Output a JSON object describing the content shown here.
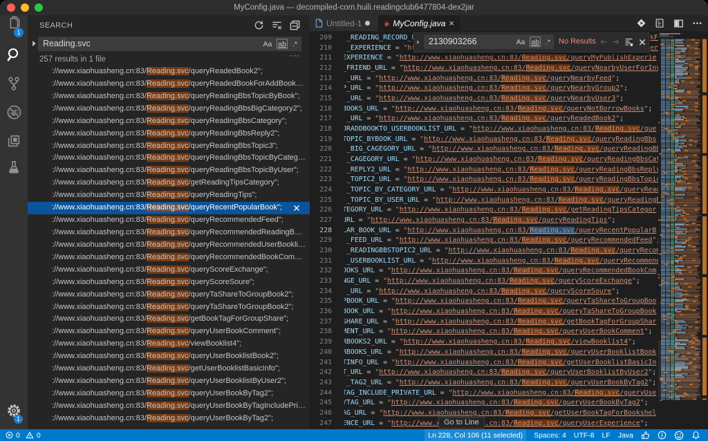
{
  "window": {
    "title": "MyConfig.java — decompiled-com.huili.readingclub6477804-dex2jar"
  },
  "colors": {
    "accent": "#007acc",
    "match_highlight": "#ea5c00",
    "selection": "#264f78",
    "list_selection": "#0a549b",
    "error_text": "#f48771"
  },
  "activity_bar": {
    "items": [
      {
        "name": "explorer",
        "badge": "1"
      },
      {
        "name": "search",
        "active": true
      },
      {
        "name": "source-control"
      },
      {
        "name": "debug-disabled"
      },
      {
        "name": "extensions"
      },
      {
        "name": "testing"
      }
    ],
    "manage_badge": "1"
  },
  "sidebar": {
    "title": "SEARCH",
    "actions": [
      "refresh",
      "clear-search-results",
      "collapse-all"
    ],
    "search_input": {
      "value": "Reading.svc",
      "options": {
        "match_case": "Aa",
        "whole_word": "ab",
        "regex": ".*"
      }
    },
    "more_label": "···",
    "results_summary": "257 results in 1 file",
    "match": "Reading.svc",
    "result_prefix": "://www.xiaohuasheng.cn:83/",
    "results": [
      {
        "suffix": "/queryReadedBook2\";"
      },
      {
        "suffix": "/queryReadedBookForAddBookT…"
      },
      {
        "suffix": "/queryReadingBbsTopicByBook\";"
      },
      {
        "suffix": "/queryReadingBbsBigCategory2\";"
      },
      {
        "suffix": "/queryReadingBbsCategory\";"
      },
      {
        "suffix": "/queryReadingBbsReply2\";"
      },
      {
        "suffix": "/queryReadingBbsTopic3\";"
      },
      {
        "suffix": "/queryReadingBbsTopicByCatego…"
      },
      {
        "suffix": "/queryReadingBbsTopicByUser\";"
      },
      {
        "suffix": "/getReadingTipsCategory\";"
      },
      {
        "suffix": "/queryReadingTips\";"
      },
      {
        "suffix": "/queryRecentPopularBook\";",
        "selected": true
      },
      {
        "suffix": "/queryRecommendedFeed\";"
      },
      {
        "suffix": "/queryRecommendedReadingBbs…"
      },
      {
        "suffix": "/queryRecommendedUserBooklis…"
      },
      {
        "suffix": "/queryRecommendedBookComm…"
      },
      {
        "suffix": "/queryScoreExchange\";"
      },
      {
        "suffix": "/queryScoreSoure\";"
      },
      {
        "suffix": "/queryTaShareToGroupBook2\";"
      },
      {
        "suffix": "/queryTaShareToGroupBook2\";"
      },
      {
        "suffix": "/getBookTagForGroupShare\";"
      },
      {
        "suffix": "/queryUserBookComment\";"
      },
      {
        "suffix": "/viewBooklist4\";"
      },
      {
        "suffix": "/queryUserBooklistBook2\";"
      },
      {
        "suffix": "/getUserBooklistBasicInfo\";"
      },
      {
        "suffix": "/queryUserBooklistByUser2\";"
      },
      {
        "suffix": "/queryUserBookByTag2\";"
      },
      {
        "suffix": "/queryUserBookByTagIncludePriv…"
      },
      {
        "suffix": "/queryUserBookByTag2\";"
      }
    ]
  },
  "editor": {
    "tabs": [
      {
        "label": "Untitled-1",
        "icon": "file",
        "modified": true
      },
      {
        "label": "MyConfig.java",
        "icon": "java",
        "active": true,
        "close": "×"
      }
    ],
    "find": {
      "value": "2130903266",
      "status": "No Results",
      "options": {
        "match_case": "Aa",
        "whole_word": "ab",
        "regex": ".*"
      }
    },
    "url_base": "http://www.xiaohuasheng.cn:83/",
    "match": "Reading.svc",
    "tooltip": "Go to Line",
    "lines": [
      {
        "n": 209,
        "id": "_READING_RECORD_U",
        "covered": true,
        "tail": "kF"
      },
      {
        "n": 210,
        "id": "_EXPERIENCE",
        "pre": "\"ht",
        "covered": true,
        "tail": "er"
      },
      {
        "n": 211,
        "cut": "E",
        "id": "XPERIENCE",
        "path": "queryMyPublishExperie"
      },
      {
        "n": 212,
        "cut": "_",
        "id": "FRIEND_URL",
        "path": "queryNearbyUserForInv"
      },
      {
        "n": 213,
        "id": "_URL",
        "path": "queryNearbyFeed",
        "end": true
      },
      {
        "n": 214,
        "cut": "P",
        "id": "_URL",
        "path": "queryNearbyGroup2",
        "end": true
      },
      {
        "n": 215,
        "id": "_URL",
        "path": "queryNearbyUser3",
        "end": true
      },
      {
        "n": 216,
        "cut": "B",
        "id": "OOKS_URL",
        "path": "queryNotBorrowBooks",
        "end": true
      },
      {
        "n": 217,
        "id": "_URL",
        "path": "queryReadedBook2",
        "end": true
      },
      {
        "n": 218,
        "cut": "O",
        "id": "RADDBOOKTO_USERBOOKLIST_URL",
        "path": "que"
      },
      {
        "n": 219,
        "cut": "T",
        "id": "OPIC_BYBOOK_URL",
        "path": "queryReadingBbs"
      },
      {
        "n": 220,
        "id": "_BIG_CAGEGORY_URL",
        "path": "queryReadingBb"
      },
      {
        "n": 221,
        "id": "_CAGEGORY_URL",
        "path": "queryReadingBbsCat"
      },
      {
        "n": 222,
        "id": "_REPLY2_URL",
        "path": "queryReadingBbsReply"
      },
      {
        "n": 223,
        "id": "_TOPIC2_URL",
        "path": "queryReadingBbsTopic"
      },
      {
        "n": 224,
        "id": "_TOPIC_BY_CATEGORY_URL",
        "path": "queryRead"
      },
      {
        "n": 225,
        "id": "_TOPIC_BY_USER_URL",
        "path": "queryReadingB"
      },
      {
        "n": 226,
        "cut": "T",
        "id": "EGORY_URL",
        "path": "getReadingTipsCategor"
      },
      {
        "n": 227,
        "cut": "U",
        "id": "RL",
        "path": "queryReadingTips",
        "end": true
      },
      {
        "n": 228,
        "cut": "L",
        "id": "AR_BOOK_URL",
        "path": "queryRecentPopularB",
        "current": true
      },
      {
        "n": 229,
        "id": "_FEED_URL",
        "path": "queryRecommendedFeed",
        "end": true
      },
      {
        "n": 230,
        "id": "_READINGBBSTOPIC2_URL",
        "path": "queryRecom"
      },
      {
        "n": 231,
        "id": "_USERBOOKLIST_URL",
        "path": "queryRecommend"
      },
      {
        "n": 232,
        "cut": "O",
        "id": "OKS_URL",
        "path": "queryRecommendedBookCom"
      },
      {
        "n": 233,
        "cut": "N",
        "id": "GE_URL",
        "path": "queryScoreExchange",
        "end": true
      },
      {
        "n": 234,
        "id": "_URL",
        "path": "queryScoreSoure",
        "end": true
      },
      {
        "n": 235,
        "cut": "P",
        "id": "BOOK_URL",
        "path": "queryTaShareToGroupBoo"
      },
      {
        "n": 236,
        "cut": "B",
        "id": "OOK_URL",
        "path": "queryTaShareToGroupBook"
      },
      {
        "n": 237,
        "cut": "S",
        "id": "HARE_URL",
        "path": "getBookTagForGroupShar"
      },
      {
        "n": 238,
        "cut": "M",
        "id": "ENT_URL",
        "path": "queryUserBookComment",
        "end": true
      },
      {
        "n": 239,
        "cut": "R",
        "id": "BOOKS2_URL",
        "path": "viewBooklist4",
        "end": true
      },
      {
        "n": 240,
        "cut": "R",
        "id": "BOOKS_URL",
        "path": "queryUserBooklistBook"
      },
      {
        "n": 241,
        "cut": "T",
        "id": "INFO_URL",
        "path": "getUserBooklistBasicIn"
      },
      {
        "n": 242,
        "cut": "T",
        "id": "_URL",
        "path": "queryUserBooklistByUser2",
        "end": true
      },
      {
        "n": 243,
        "id": "_TAG2_URL",
        "path": "queryUserBookByTag2",
        "end": true
      },
      {
        "n": 244,
        "cut": "T",
        "id": "AG_INCLUDE_PRIVATE_URL",
        "path": "queryUse"
      },
      {
        "n": 245,
        "cut": "Y",
        "id": "TAG_URL",
        "path": "queryUserBookByTag2",
        "end": true
      },
      {
        "n": 246,
        "cut": "A",
        "id": "G_URL",
        "path": "getUserBookTagForBookshel"
      },
      {
        "n": 247,
        "cut": "E",
        "id": "NCE_URL",
        "path": "queryUserExperience",
        "end": true
      }
    ]
  },
  "status_bar": {
    "errors": "0",
    "warnings": "0",
    "cursor": "Ln 228, Col 106 (11 selected)",
    "indent": "Spaces: 4",
    "encoding": "UTF-8",
    "eol": "LF",
    "language": "Java",
    "icons": [
      "thumbsup",
      "info",
      "smiley",
      "bell"
    ]
  }
}
